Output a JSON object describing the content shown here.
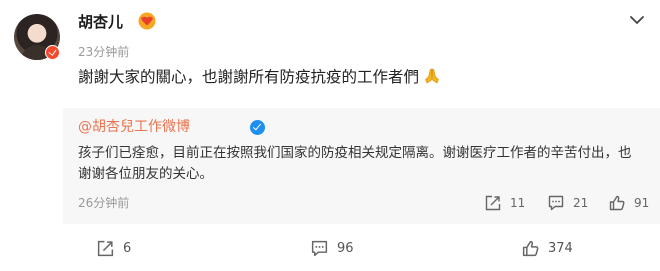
{
  "post": {
    "username": "胡杏儿",
    "timestamp": "23分钟前",
    "text": "謝謝大家的關心，也謝謝所有防疫抗疫的工作者們",
    "level_badge_icon": "heart-level-badge-icon",
    "more_icon": "chevron-down-icon",
    "retweet": {
      "author": "@胡杏兒工作微博",
      "verified_icon": "blue-v-verified-icon",
      "text": "孩子们已痊愈，目前正在按照我们国家的防疫相关规定隔离。谢谢医疗工作者的辛苦付出，也谢谢各位朋友的关心。",
      "timestamp": "26分钟前",
      "stats": {
        "reposts": "11",
        "comments": "21",
        "likes": "91"
      }
    },
    "stats": {
      "reposts": "6",
      "comments": "96",
      "likes": "374"
    },
    "colors": {
      "author_link": "#eb7350",
      "verified_blue": "#1d8ff0",
      "badge_orange": "#f24a2b"
    }
  }
}
